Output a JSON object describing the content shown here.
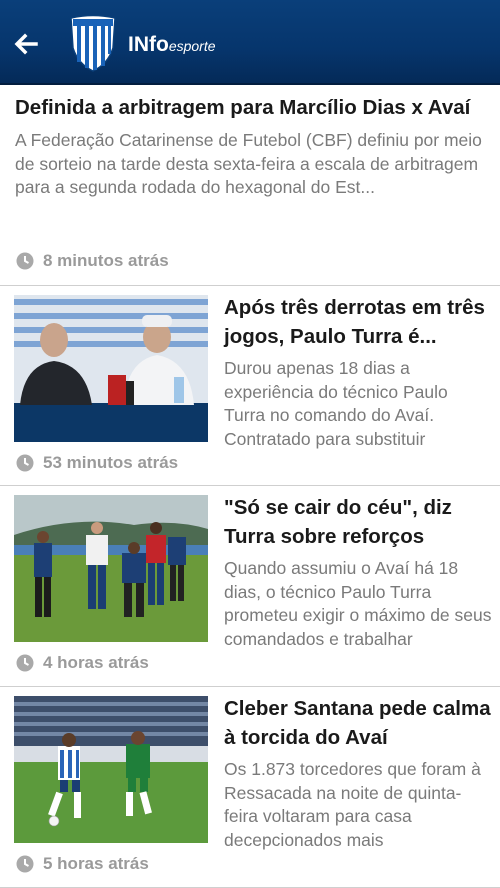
{
  "header": {
    "logo_text_main": "INfo",
    "logo_text_sub": "esporte",
    "shield_icon": "avai-shield-icon",
    "back_icon": "back-arrow-icon"
  },
  "colors": {
    "header_bg": "#06356c",
    "title": "#1a1a1a",
    "summary": "#7a7a7a",
    "time": "#9a9a9a"
  },
  "articles": [
    {
      "title": "Definida a arbitragem para Marcílio Dias x Avaí",
      "summary": "A Federação Catarinense de Futebol (CBF) definiu por meio de sorteio na tarde desta sexta-feira a escala de arbitragem para a segunda rodada do hexagonal do Est...",
      "time": "8 minutos atrás"
    },
    {
      "title": "Após três derrotas em três jogos, Paulo Turra é...",
      "summary": "Durou apenas 18 dias a experiência do técnico Paulo Turra no comando do Avaí. Contratado para substituir",
      "time": "53 minutos atrás",
      "image": "press-conference-photo"
    },
    {
      "title": "\"Só se cair do céu\", diz Turra sobre reforços",
      "summary": "Quando assumiu o Avaí há 18 dias, o técnico Paulo Turra prometeu exigir o máximo de seus comandados e trabalhar",
      "time": "4 horas atrás",
      "image": "training-photo"
    },
    {
      "title": "Cleber Santana pede calma à torcida do Avaí",
      "summary": "Os 1.873 torcedores que foram à Ressacada na noite de quinta-feira voltaram para casa decepcionados mais",
      "time": "5 horas atrás",
      "image": "match-photo"
    }
  ]
}
